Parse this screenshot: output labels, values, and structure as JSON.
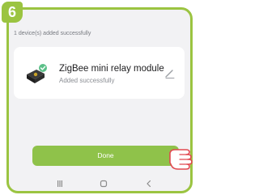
{
  "step": {
    "number": "6"
  },
  "header": {
    "status_text": "1 device(s) added successfully"
  },
  "device": {
    "name": "ZigBee mini relay module",
    "status": "Added successfully",
    "icon": "relay-module-icon",
    "badge_icon": "check-badge-icon"
  },
  "actions": {
    "done_label": "Done"
  },
  "navbar": {
    "items": [
      "recents-icon",
      "home-icon",
      "back-icon"
    ]
  },
  "colors": {
    "accent": "#9bc441",
    "button": "#8fc24a",
    "background": "#f2f2f4",
    "card": "#ffffff"
  }
}
